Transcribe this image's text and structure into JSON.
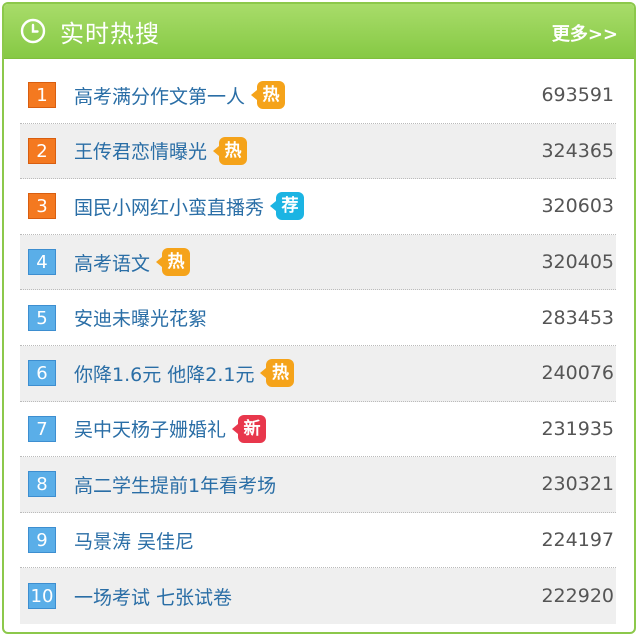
{
  "header": {
    "icon": "clock-icon",
    "title": "实时热搜",
    "more": "更多>>"
  },
  "colors": {
    "header_green": "#86c944",
    "top_rank": "#f47920",
    "normal_rank": "#5aaee8",
    "link_text": "#2a6ea6",
    "badge_hot": "#f5a31a",
    "badge_recommend": "#1bb4e3",
    "badge_new": "#e8374c"
  },
  "items": [
    {
      "rank": "1",
      "text": "高考满分作文第一人",
      "badge": "热",
      "badge_type": "hot",
      "count": "693591"
    },
    {
      "rank": "2",
      "text": "王传君恋情曝光",
      "badge": "热",
      "badge_type": "hot",
      "count": "324365"
    },
    {
      "rank": "3",
      "text": "国民小网红小蛮直播秀",
      "badge": "荐",
      "badge_type": "recommend",
      "count": "320603"
    },
    {
      "rank": "4",
      "text": "高考语文",
      "badge": "热",
      "badge_type": "hot",
      "count": "320405"
    },
    {
      "rank": "5",
      "text": "安迪未曝光花絮",
      "badge": "",
      "badge_type": "",
      "count": "283453"
    },
    {
      "rank": "6",
      "text": "你降1.6元 他降2.1元",
      "badge": "热",
      "badge_type": "hot",
      "count": "240076"
    },
    {
      "rank": "7",
      "text": "吴中天杨子姗婚礼",
      "badge": "新",
      "badge_type": "new",
      "count": "231935"
    },
    {
      "rank": "8",
      "text": "高二学生提前1年看考场",
      "badge": "",
      "badge_type": "",
      "count": "230321"
    },
    {
      "rank": "9",
      "text": "马景涛 吴佳尼",
      "badge": "",
      "badge_type": "",
      "count": "224197"
    },
    {
      "rank": "10",
      "text": "一场考试 七张试卷",
      "badge": "",
      "badge_type": "",
      "count": "222920"
    }
  ]
}
